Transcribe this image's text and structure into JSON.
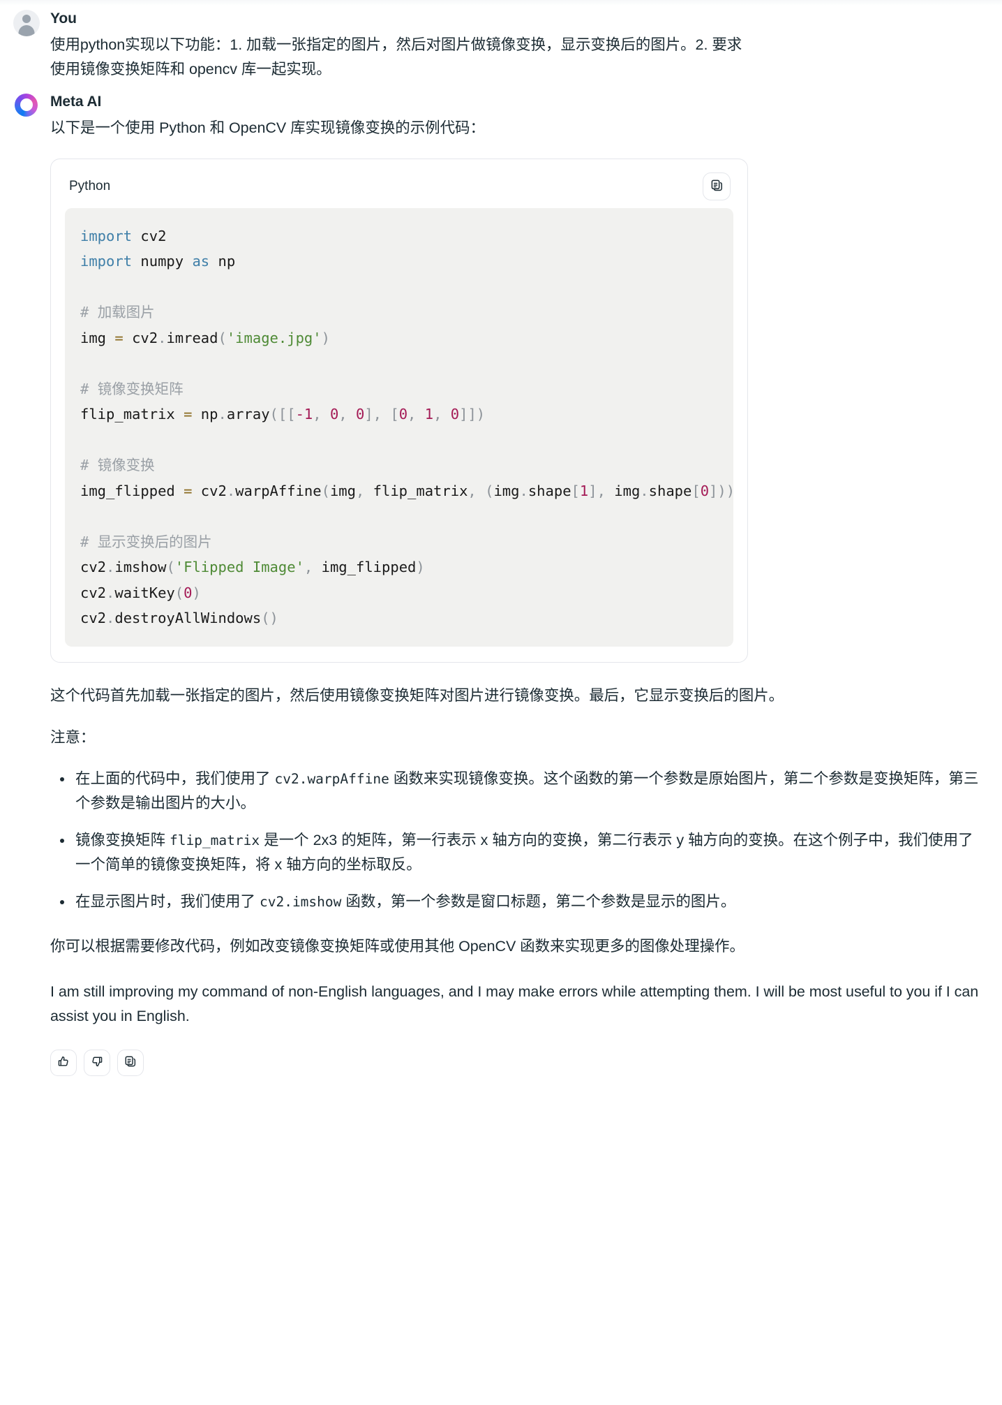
{
  "conversation": {
    "messages": [
      {
        "sender": "You",
        "avatar_icon": "user-avatar-icon",
        "text": "使用python实现以下功能：1. 加载一张指定的图片，然后对图片做镜像变换，显示变换后的图片。2. 要求使用镜像变换矩阵和 opencv 库一起实现。"
      },
      {
        "sender": "Meta AI",
        "avatar_icon": "meta-ai-ring-icon",
        "intro": "以下是一个使用 Python 和 OpenCV 库实现镜像变换的示例代码：",
        "summary": "这个代码首先加载一张指定的图片，然后使用镜像变换矩阵对图片进行镜像变换。最后，它显示变换后的图片。",
        "notes_label": "注意：",
        "closing": "你可以根据需要修改代码，例如改变镜像变换矩阵或使用其他 OpenCV 函数来实现更多的图像处理操作。",
        "disclaimer": "I am still improving my command of non-English languages, and I may make errors while attempting them. I will be most useful to you if I can assist you in English."
      }
    ]
  },
  "code_block": {
    "language_label": "Python",
    "copy_button_icon": "copy-icon",
    "copy_button_label": "",
    "lines": [
      "import cv2",
      "import numpy as np",
      "",
      "# 加载图片",
      "img = cv2.imread('image.jpg')",
      "",
      "# 镜像变换矩阵",
      "flip_matrix = np.array([[-1, 0, 0], [0, 1, 0]])",
      "",
      "# 镜像变换",
      "img_flipped = cv2.warpAffine(img, flip_matrix, (img.shape[1], img.shape[0]))",
      "",
      "# 显示变换后的图片",
      "cv2.imshow('Flipped Image', img_flipped)",
      "cv2.waitKey(0)",
      "cv2.destroyAllWindows()"
    ]
  },
  "notes": [
    {
      "parts": [
        {
          "type": "text",
          "value": "在上面的代码中，我们使用了 "
        },
        {
          "type": "code",
          "value": "cv2.warpAffine"
        },
        {
          "type": "text",
          "value": " 函数来实现镜像变换。这个函数的第一个参数是原始图片，第二个参数是变换矩阵，第三个参数是输出图片的大小。"
        }
      ]
    },
    {
      "parts": [
        {
          "type": "text",
          "value": "镜像变换矩阵 "
        },
        {
          "type": "code",
          "value": "flip_matrix"
        },
        {
          "type": "text",
          "value": " 是一个 2x3 的矩阵，第一行表示 x 轴方向的变换，第二行表示 y 轴方向的变换。在这个例子中，我们使用了一个简单的镜像变换矩阵，将 x 轴方向的坐标取反。"
        }
      ]
    },
    {
      "parts": [
        {
          "type": "text",
          "value": "在显示图片时，我们使用了 "
        },
        {
          "type": "code",
          "value": "cv2.imshow"
        },
        {
          "type": "text",
          "value": " 函数，第一个参数是窗口标题，第二个参数是显示的图片。"
        }
      ]
    }
  ],
  "feedback_actions": [
    {
      "name": "thumbs-up-button",
      "icon": "thumbs-up-icon",
      "label": ""
    },
    {
      "name": "thumbs-down-button",
      "icon": "thumbs-down-icon",
      "label": ""
    },
    {
      "name": "copy-response-button",
      "icon": "copy-icon",
      "label": ""
    }
  ],
  "colors": {
    "text": "#1c2b33",
    "code_bg": "#f1f1ef",
    "border": "#e4e6eb",
    "keyword": "#3f7fa8",
    "comment": "#9aa0a6",
    "string": "#4e8a35",
    "number": "#a41b56",
    "operator": "#8a6a1f"
  }
}
